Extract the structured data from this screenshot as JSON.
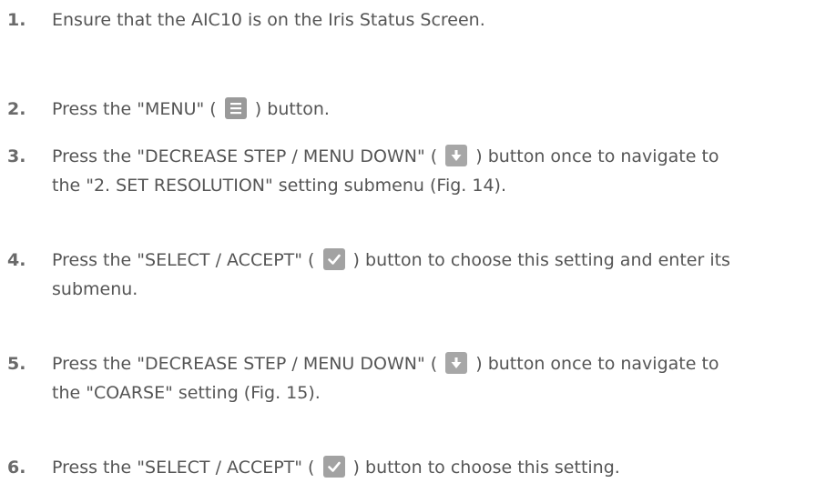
{
  "steps": [
    {
      "number": "1.",
      "lines": [
        "Ensure that the AIC10 is on the Iris Status Screen."
      ]
    },
    {
      "number": "2.",
      "before_icon": "Press the \"MENU\" (",
      "icon": "menu-icon",
      "after_icon": ") button."
    },
    {
      "number": "3.",
      "before_icon": "Press the \"DECREASE STEP / MENU DOWN\" (",
      "icon": "arrow-down-icon",
      "after_icon": ") button once to navigate to",
      "line2": "the \"2. SET RESOLUTION\" setting submenu (Fig. 14)."
    },
    {
      "number": "4.",
      "before_icon": "Press the \"SELECT / ACCEPT\" (",
      "icon": "checkmark-icon",
      "after_icon": ") button to choose this setting and enter its",
      "line2": "submenu."
    },
    {
      "number": "5.",
      "before_icon": "Press the \"DECREASE STEP / MENU DOWN\" (",
      "icon": "arrow-down-icon",
      "after_icon": ") button once to navigate to",
      "line2": "the \"COARSE\" setting (Fig. 15)."
    },
    {
      "number": "6.",
      "before_icon": "Press the \"SELECT / ACCEPT\" (",
      "icon": "checkmark-icon",
      "after_icon": ") button to choose this setting."
    }
  ],
  "colors": {
    "text": "#555555",
    "number": "#6a6a6a",
    "icon_background": "#9e9e9e",
    "icon_foreground": "#ffffff"
  }
}
